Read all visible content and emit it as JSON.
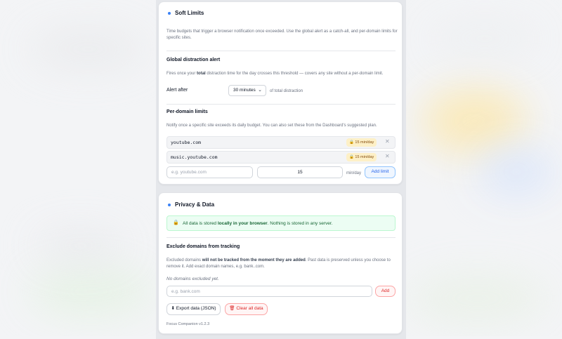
{
  "soft_limits": {
    "title": "Soft Limits",
    "description": "Time budgets that trigger a browser notification once exceeded. Use the global alert as a catch-all, and per-domain limits for specific sites.",
    "global": {
      "heading": "Global distraction alert",
      "desc_prefix": "Fires once your ",
      "desc_bold": "total",
      "desc_suffix": " distraction time for the day crosses this threshold — covers any site without a per-domain limit.",
      "alert_label": "Alert after",
      "selected_option": "30 minutes",
      "select_suffix": "of total distraction"
    },
    "per_domain": {
      "heading": "Per-domain limits",
      "description": "Notify once a specific site exceeds its daily budget. You can also set these from the Dashboard's suggested plan.",
      "limits": [
        {
          "domain": "youtube.com",
          "badge": "15 min/day"
        },
        {
          "domain": "music.youtube.com",
          "badge": "15 min/day"
        }
      ],
      "domain_placeholder": "e.g. youtube.com",
      "minutes_value": "15",
      "unit_label": "min/day",
      "add_button": "Add limit"
    }
  },
  "privacy": {
    "title": "Privacy & Data",
    "notice_prefix": "All data is stored ",
    "notice_bold": "locally in your browser",
    "notice_suffix": ". Nothing is stored in any server.",
    "exclude": {
      "heading": "Exclude domains from tracking",
      "desc_prefix": "Excluded domains ",
      "desc_bold": "will not be tracked from the moment they are added",
      "desc_suffix": ". Past data is preserved unless you choose to remove it. Add exact domain names, e.g. bank..com.",
      "empty_text": "No domains excluded yet.",
      "input_placeholder": "e.g. bank.com",
      "add_button": "Add"
    },
    "export_button": "Export data (JSON)",
    "clear_button": "Clear all data",
    "version": "Focus Companion v1.2.3"
  },
  "colors": {
    "accent": "#3b82f6",
    "danger": "#dc2626",
    "success_bg": "#ecfdf3",
    "badge_bg": "#fdf0c7"
  },
  "icons": {
    "badge_icon": "lock-icon",
    "remove_icon": "close-icon",
    "notice_icon": "lock-icon",
    "export_icon": "download-icon",
    "clear_icon": "trash-icon"
  }
}
